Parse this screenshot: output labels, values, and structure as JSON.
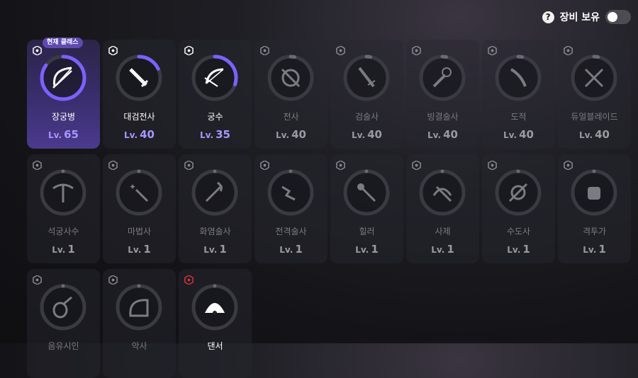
{
  "header": {
    "help_icon": "question-circle-icon",
    "own_gear_label": "장비 보유",
    "own_gear_toggle": false
  },
  "current_badge": "현재 클래스",
  "classes": [
    {
      "name": "장궁병",
      "lv_prefix": "Lv.",
      "level": "65",
      "state": "current",
      "progress": 0.85,
      "icon": "longbow-icon"
    },
    {
      "name": "대검전사",
      "lv_prefix": "Lv.",
      "level": "40",
      "state": "active",
      "progress": 0.18,
      "icon": "greatsword-icon"
    },
    {
      "name": "궁수",
      "lv_prefix": "Lv.",
      "level": "35",
      "state": "active",
      "progress": 0.3,
      "icon": "bow-icon"
    },
    {
      "name": "전사",
      "lv_prefix": "Lv.",
      "level": "40",
      "state": "locked",
      "progress": 0.03,
      "icon": "shield-sword-icon"
    },
    {
      "name": "검술사",
      "lv_prefix": "Lv.",
      "level": "40",
      "state": "locked",
      "progress": 0.03,
      "icon": "sword-icon"
    },
    {
      "name": "빙결술사",
      "lv_prefix": "Lv.",
      "level": "40",
      "state": "locked",
      "progress": 0.03,
      "icon": "frost-staff-icon"
    },
    {
      "name": "도적",
      "lv_prefix": "Lv.",
      "level": "40",
      "state": "locked",
      "progress": 0.03,
      "icon": "dagger-icon"
    },
    {
      "name": "듀얼블레이드",
      "lv_prefix": "Lv.",
      "level": "40",
      "state": "locked",
      "progress": 0.03,
      "icon": "dual-blades-icon"
    },
    {
      "name": "석궁사수",
      "lv_prefix": "Lv.",
      "level": "1",
      "state": "locked",
      "progress": 0,
      "icon": "crossbow-icon"
    },
    {
      "name": "마법사",
      "lv_prefix": "Lv.",
      "level": "1",
      "state": "locked",
      "progress": 0,
      "icon": "magic-wand-icon"
    },
    {
      "name": "화염술사",
      "lv_prefix": "Lv.",
      "level": "1",
      "state": "locked",
      "progress": 0,
      "icon": "fire-staff-icon"
    },
    {
      "name": "전격술사",
      "lv_prefix": "Lv.",
      "level": "1",
      "state": "locked",
      "progress": 0,
      "icon": "lightning-staff-icon"
    },
    {
      "name": "힐러",
      "lv_prefix": "Lv.",
      "level": "1",
      "state": "locked",
      "progress": 0,
      "icon": "mace-icon"
    },
    {
      "name": "사제",
      "lv_prefix": "Lv.",
      "level": "1",
      "state": "locked",
      "progress": 0,
      "icon": "holy-staff-icon"
    },
    {
      "name": "수도사",
      "lv_prefix": "Lv.",
      "level": "1",
      "state": "locked",
      "progress": 0,
      "icon": "scroll-staff-icon"
    },
    {
      "name": "격투가",
      "lv_prefix": "Lv.",
      "level": "1",
      "state": "locked",
      "progress": 0,
      "icon": "fist-icon"
    },
    {
      "name": "음유시인",
      "lv_prefix": "",
      "level": "",
      "state": "locked",
      "progress": 0,
      "icon": "lute-icon"
    },
    {
      "name": "악사",
      "lv_prefix": "",
      "level": "",
      "state": "locked",
      "progress": 0,
      "icon": "harp-icon"
    },
    {
      "name": "댄서",
      "lv_prefix": "",
      "level": "",
      "state": "special",
      "progress": 0,
      "icon": "fan-icon"
    }
  ],
  "colors": {
    "accent": "#7b61ff",
    "ring_track": "#3a3a42",
    "gear_red": "#d8333a"
  }
}
